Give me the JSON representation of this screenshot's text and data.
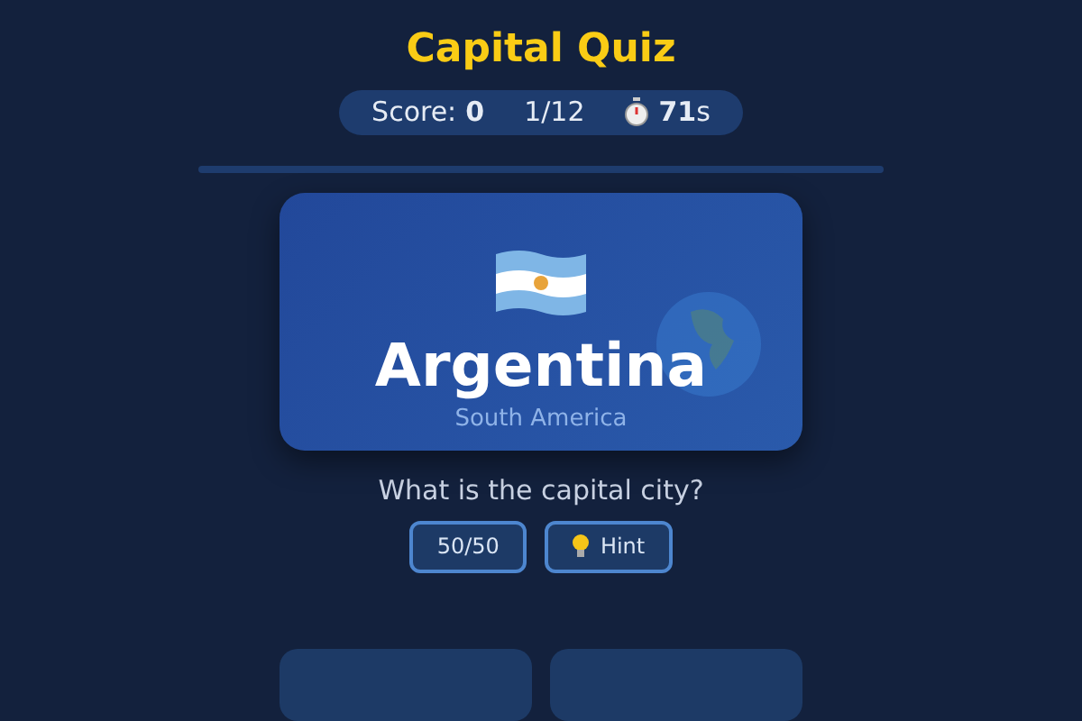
{
  "title": "Capital Quiz",
  "stats": {
    "score_label": "Score:",
    "score": "0",
    "progress": "1/12",
    "time": "71",
    "time_unit": "s"
  },
  "progress_bar": {
    "level": 0
  },
  "card": {
    "country": "Argentina",
    "region": "South America"
  },
  "question": "What is the capital city?",
  "lifelines": [
    {
      "label": "50/50",
      "kind": "plain"
    },
    {
      "label": "Hint",
      "kind": "hint"
    }
  ],
  "answers": [
    {
      "kind": "option"
    },
    {
      "kind": "option"
    }
  ]
}
